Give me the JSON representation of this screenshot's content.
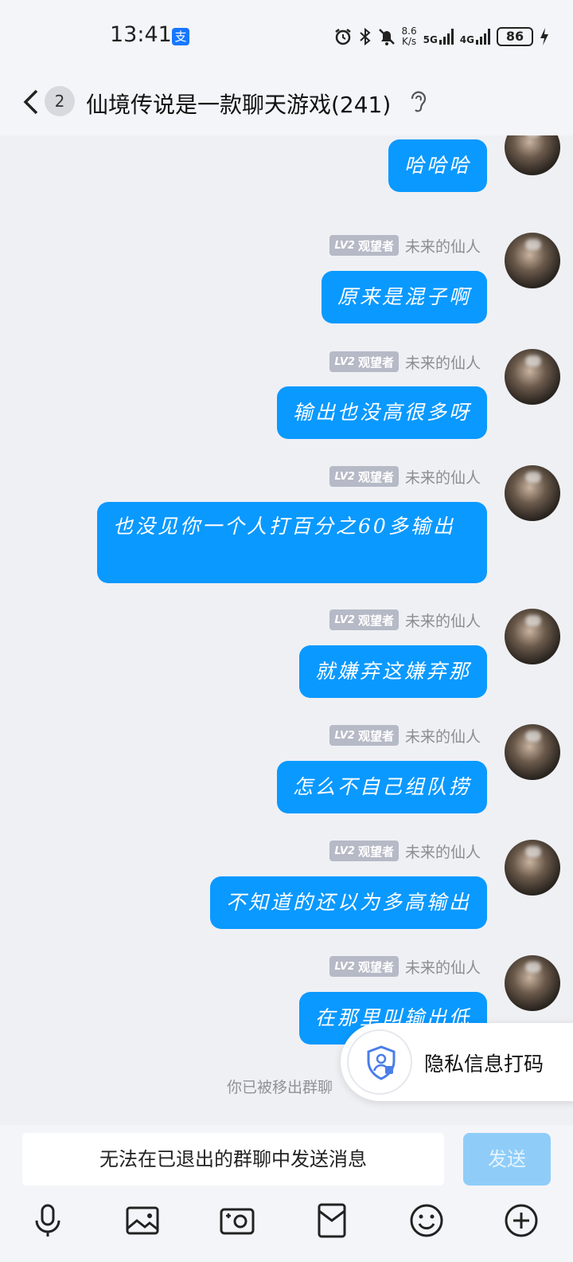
{
  "status": {
    "time": "13:41",
    "alipay_badge": "支",
    "net_speed_top": "8.6",
    "net_speed_bottom": "K/s",
    "sig1": "5G",
    "sig2": "4G",
    "battery": "86"
  },
  "header": {
    "unread_count": "2",
    "title": "仙境传说是一款聊天游戏(241)"
  },
  "sender": {
    "level": "LV2",
    "role": "观望者",
    "nickname": "未来的仙人"
  },
  "messages": [
    {
      "text": "哈哈哈"
    },
    {
      "text": "原来是混子啊"
    },
    {
      "text": "输出也没高很多呀"
    },
    {
      "text": "也没见你一个人打百分之60多输出"
    },
    {
      "text": "就嫌弃这嫌弃那"
    },
    {
      "text": "怎么不自己组队捞"
    },
    {
      "text": "不知道的还以为多高输出"
    },
    {
      "text": "在那里叫输出低"
    }
  ],
  "notice": "你已被移出群聊",
  "privacy_popup": {
    "label": "隐私信息打码"
  },
  "input": {
    "placeholder": "无法在已退出的群聊中发送消息",
    "send_label": "发送"
  },
  "toolbar_icons": [
    "mic-icon",
    "image-icon",
    "camera-icon",
    "red-packet-icon",
    "emoji-icon",
    "plus-icon"
  ],
  "colors": {
    "bubble": "#0a99ff",
    "background": "#eff0f4",
    "send_disabled": "#8fcdf8"
  }
}
